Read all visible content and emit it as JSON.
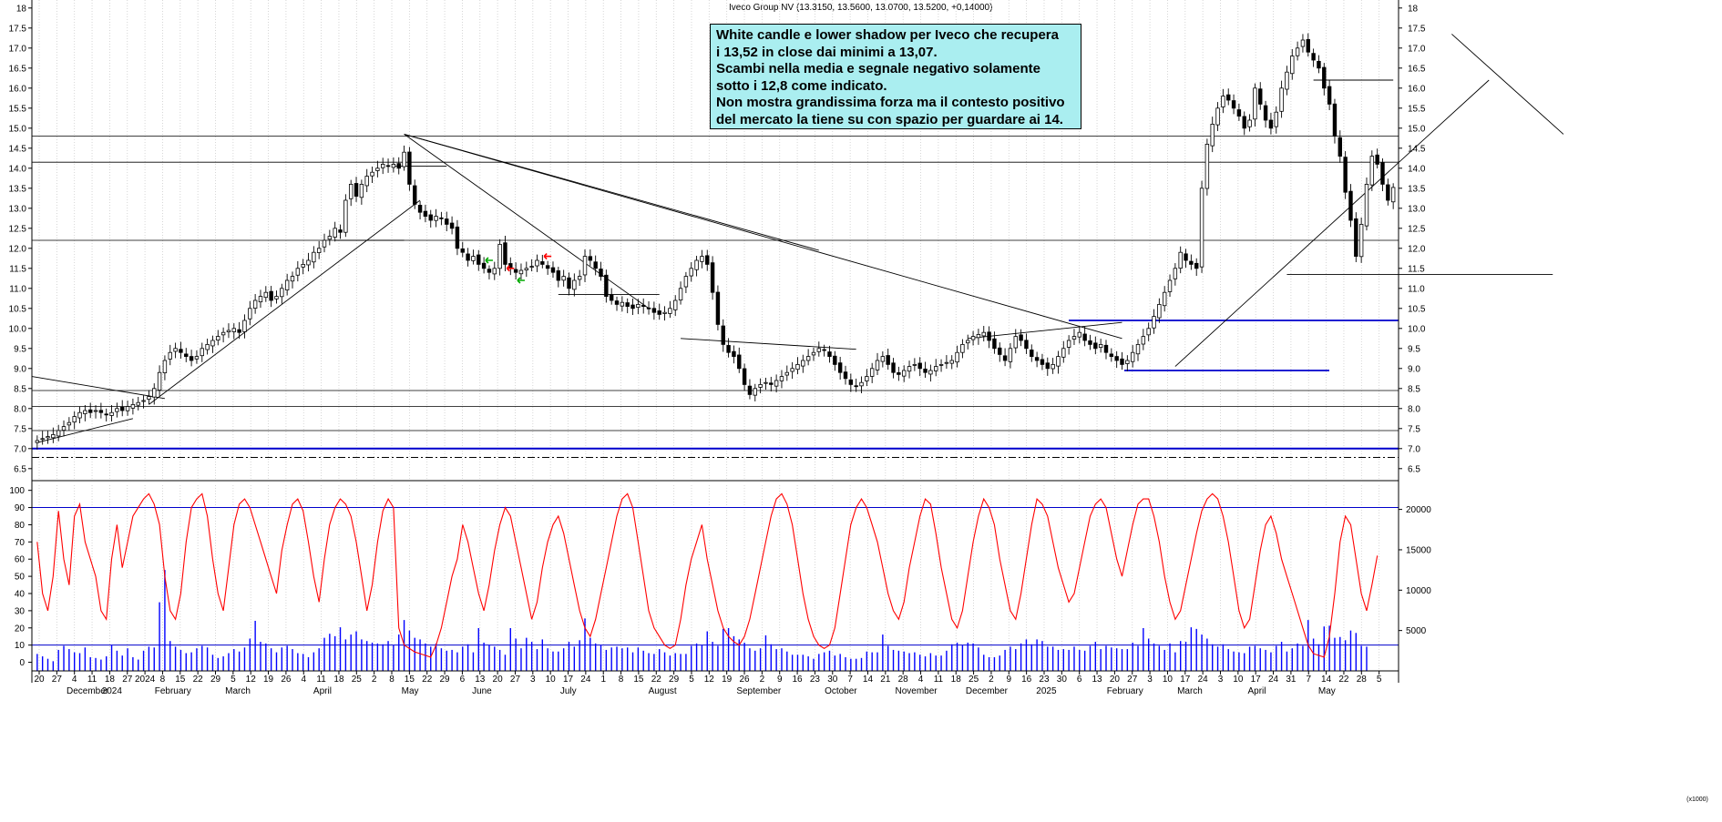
{
  "header": {
    "instrument": "Iveco Group NV",
    "values": "(13.3150, 13.5600, 13.0700, 13.5200, +0,14000)"
  },
  "annotation": {
    "lines": [
      "White candle e lower shadow per Iveco che recupera",
      "i 13,52 in close dai minimi a 13,07.",
      "Scambi nella media e segnale negativo solamente",
      "sotto i 12,8 come indicato.",
      "Non mostra grandissima forza ma il contesto positivo",
      "del mercato la tiene su con spazio per guardare ai 14."
    ]
  },
  "corner_label": "(x1000)",
  "colors": {
    "trend_black": "#000000",
    "level_blue": "#0000cc",
    "oscillator_red": "#ff0000",
    "volume_blue": "#0000ff",
    "note_bg": "#aaeef0"
  },
  "chart_data": [
    {
      "type": "candlestick",
      "panel": "price",
      "y_axis": {
        "ticks": [
          "6.5",
          "7.0",
          "7.5",
          "8.0",
          "8.5",
          "9.0",
          "9.5",
          "10.0",
          "10.5",
          "11.0",
          "11.5",
          "12.0",
          "12.5",
          "13.0",
          "13.5",
          "14.0",
          "14.5",
          "15.0",
          "15.5",
          "16.0",
          "16.5",
          "17.0",
          "17.5",
          "18"
        ],
        "sides": "both"
      },
      "ylim": [
        6.2,
        18.2
      ],
      "grid": "vertical-dotted",
      "series": [
        {
          "close": [
            7.2,
            7.25,
            7.3,
            7.35,
            7.45,
            7.55,
            7.65,
            7.8,
            7.9,
            7.95,
            7.9,
            7.95,
            7.9,
            7.85,
            7.9,
            8.0,
            7.95,
            8.05,
            8.1,
            8.15,
            8.2,
            8.3,
            8.5,
            8.9,
            9.2,
            9.4,
            9.5,
            9.4,
            9.3,
            9.2,
            9.3,
            9.5,
            9.6,
            9.7,
            9.8,
            9.9,
            9.95,
            10.0,
            9.9,
            10.2,
            10.5,
            10.7,
            10.8,
            10.9,
            10.7,
            10.8,
            11.0,
            11.2,
            11.3,
            11.5,
            11.6,
            11.7,
            11.9,
            12.0,
            12.2,
            12.3,
            12.5,
            12.4,
            13.2,
            13.6,
            13.3,
            13.6,
            13.8,
            13.9,
            14.0,
            14.1,
            14.05,
            14.1,
            14.0,
            14.4,
            13.6,
            13.1,
            12.9,
            12.8,
            12.7,
            12.8,
            12.75,
            12.6,
            12.5,
            12.0,
            11.9,
            11.7,
            11.8,
            11.6,
            11.5,
            11.4,
            11.5,
            12.1,
            11.6,
            11.5,
            11.4,
            11.45,
            11.5,
            11.55,
            11.7,
            11.6,
            11.5,
            11.4,
            11.2,
            11.3,
            11.0,
            11.2,
            11.3,
            11.8,
            11.7,
            11.5,
            11.3,
            10.8,
            10.7,
            10.6,
            10.65,
            10.55,
            10.5,
            10.6,
            10.55,
            10.5,
            10.4,
            10.35,
            10.4,
            10.5,
            10.7,
            11.0,
            11.3,
            11.5,
            11.7,
            11.8,
            11.6,
            10.9,
            10.1,
            9.6,
            9.4,
            9.3,
            9.0,
            8.6,
            8.35,
            8.5,
            8.6,
            8.65,
            8.6,
            8.7,
            8.8,
            8.9,
            9.0,
            9.1,
            9.2,
            9.3,
            9.4,
            9.5,
            9.45,
            9.3,
            9.1,
            8.9,
            8.75,
            8.6,
            8.55,
            8.65,
            8.8,
            9.0,
            9.2,
            9.3,
            9.1,
            8.9,
            8.85,
            8.95,
            9.05,
            9.1,
            9.0,
            8.9,
            8.95,
            9.05,
            9.1,
            9.15,
            9.2,
            9.4,
            9.6,
            9.7,
            9.8,
            9.85,
            9.9,
            9.7,
            9.5,
            9.35,
            9.2,
            9.5,
            9.8,
            9.7,
            9.5,
            9.3,
            9.2,
            9.1,
            9.0,
            9.1,
            9.3,
            9.5,
            9.7,
            9.8,
            9.9,
            9.7,
            9.6,
            9.5,
            9.6,
            9.4,
            9.3,
            9.2,
            9.1,
            9.2,
            9.4,
            9.6,
            9.8,
            10.0,
            10.3,
            10.6,
            10.9,
            11.2,
            11.5,
            11.9,
            11.7,
            11.6,
            11.5,
            13.5,
            14.6,
            15.1,
            15.5,
            15.8,
            15.7,
            15.5,
            15.3,
            15.0,
            15.2,
            16.0,
            15.6,
            15.2,
            15.0,
            15.4,
            16.0,
            16.4,
            16.8,
            17.0,
            17.2,
            16.9,
            16.7,
            16.5,
            16.0,
            15.6,
            14.8,
            14.3,
            13.4,
            12.7,
            11.8,
            12.6,
            13.6,
            14.3,
            14.1,
            13.6,
            13.2,
            13.52
          ]
        }
      ]
    },
    {
      "type": "line",
      "panel": "oscillator",
      "y_axis": {
        "ticks": [
          "0",
          "10",
          "20",
          "30",
          "40",
          "50",
          "60",
          "70",
          "80",
          "90",
          "100"
        ],
        "side": "left"
      },
      "ylim": [
        -5,
        103
      ],
      "reference_lines": [
        10,
        90
      ],
      "series": [
        {
          "values": [
            70,
            40,
            30,
            50,
            88,
            60,
            45,
            85,
            92,
            70,
            60,
            50,
            30,
            25,
            60,
            80,
            55,
            70,
            85,
            90,
            95,
            98,
            92,
            80,
            50,
            30,
            25,
            40,
            70,
            90,
            95,
            98,
            85,
            60,
            40,
            30,
            55,
            80,
            92,
            95,
            90,
            80,
            70,
            60,
            50,
            40,
            65,
            80,
            92,
            95,
            88,
            70,
            50,
            35,
            60,
            80,
            90,
            95,
            92,
            85,
            70,
            50,
            30,
            45,
            70,
            88,
            95,
            90,
            20,
            10,
            8,
            6,
            5,
            4,
            3,
            10,
            20,
            35,
            50,
            60,
            80,
            70,
            55,
            40,
            30,
            45,
            65,
            80,
            90,
            85,
            70,
            55,
            40,
            25,
            35,
            55,
            70,
            80,
            85,
            75,
            60,
            45,
            30,
            20,
            15,
            25,
            40,
            55,
            70,
            85,
            95,
            98,
            90,
            70,
            50,
            30,
            20,
            15,
            10,
            8,
            10,
            25,
            45,
            60,
            70,
            80,
            60,
            45,
            30,
            20,
            15,
            12,
            10,
            15,
            25,
            40,
            55,
            70,
            85,
            95,
            98,
            92,
            80,
            60,
            40,
            25,
            15,
            10,
            8,
            10,
            20,
            40,
            60,
            80,
            90,
            95,
            90,
            80,
            70,
            55,
            40,
            30,
            25,
            35,
            55,
            70,
            85,
            95,
            92,
            75,
            55,
            40,
            25,
            20,
            30,
            50,
            70,
            85,
            95,
            90,
            80,
            60,
            45,
            30,
            25,
            40,
            60,
            80,
            95,
            92,
            85,
            70,
            55,
            45,
            35,
            40,
            55,
            70,
            85,
            92,
            95,
            90,
            75,
            60,
            50,
            65,
            80,
            92,
            95,
            95,
            85,
            70,
            50,
            35,
            25,
            30,
            45,
            60,
            75,
            88,
            95,
            98,
            95,
            85,
            70,
            50,
            30,
            20,
            25,
            45,
            65,
            80,
            85,
            75,
            60,
            50,
            40,
            30,
            20,
            10,
            5,
            4,
            3,
            15,
            40,
            70,
            85,
            80,
            60,
            40,
            30,
            45,
            62
          ]
        }
      ]
    },
    {
      "type": "bar",
      "panel": "volume",
      "y_axis": {
        "ticks": [
          "5000",
          "10000",
          "15000",
          "20000"
        ],
        "side": "right",
        "unit_label": "(x1000)"
      },
      "ylim": [
        0,
        23000
      ],
      "series": [
        {
          "values": [
            2100,
            1800,
            1500,
            1200,
            2600,
            3100,
            2700,
            2300,
            2200,
            2900,
            1700,
            1600,
            1400,
            1800,
            3200,
            2500,
            1900,
            2800,
            1700,
            1400,
            2500,
            3000,
            2900,
            8500,
            12500,
            3700,
            3000,
            2600,
            2200,
            2300,
            2800,
            3100,
            2900,
            2000,
            1600,
            1800,
            2200,
            2700,
            2400,
            2900,
            4000,
            6200,
            3600,
            3400,
            2800,
            2300,
            2900,
            3100,
            2700,
            2200,
            2100,
            1700,
            2300,
            2800,
            4100,
            4600,
            4300,
            5400,
            3900,
            4500,
            4900,
            3900,
            3700,
            3500,
            3400,
            3300,
            3700,
            3200,
            4500,
            6300,
            5000,
            4100,
            3900,
            3400,
            3000,
            3400,
            2800,
            2500,
            2600,
            2300,
            3000,
            3300,
            2300,
            5300,
            3500,
            3200,
            3000,
            2600,
            2000,
            5300,
            4000,
            2800,
            4100,
            3600,
            2700,
            3900,
            2800,
            2400,
            2400,
            2800,
            3600,
            3000,
            3800,
            6500,
            4100,
            3400,
            3200,
            2600,
            2900,
            3000,
            2800,
            2900,
            2300,
            2900,
            2500,
            2200,
            2100,
            2700,
            2300,
            1900,
            2200,
            2100,
            2100,
            3100,
            3400,
            3200,
            4900,
            3600,
            3100,
            5200,
            5300,
            4300,
            3900,
            3500,
            2800,
            2500,
            2800,
            4400,
            3300,
            2700,
            2800,
            2400,
            2000,
            2000,
            2000,
            1800,
            1500,
            2100,
            2300,
            2500,
            1900,
            2100,
            1700,
            1500,
            1500,
            1600,
            2400,
            2300,
            2300,
            4500,
            3100,
            2600,
            2500,
            2400,
            2200,
            2300,
            2000,
            1800,
            2200,
            1900,
            1900,
            2500,
            3300,
            3500,
            3200,
            3500,
            3400,
            2900,
            2000,
            1700,
            1700,
            1900,
            2600,
            3000,
            2700,
            3400,
            3900,
            3300,
            3900,
            3700,
            3000,
            3000,
            2600,
            2700,
            2600,
            3000,
            2600,
            2500,
            3100,
            3600,
            2700,
            3100,
            2900,
            2800,
            2700,
            2700,
            3500,
            3100,
            5300,
            4000,
            3400,
            3100,
            2600,
            3400,
            2300,
            3700,
            3600,
            5400,
            5200,
            4500,
            4000,
            3300,
            3000,
            3300,
            2700,
            2400,
            2300,
            2200,
            3000,
            3100,
            2800,
            2600,
            2300,
            3100,
            3600,
            2400,
            2800,
            3400,
            3100,
            6300,
            4000,
            3300,
            5500,
            5600,
            4100,
            4200,
            3800,
            5000,
            4700,
            3100,
            3000
          ]
        }
      ]
    }
  ],
  "x_axis": {
    "day_ticks": [
      "20",
      "27",
      "4",
      "11",
      "18",
      "27",
      "2024",
      "8",
      "15",
      "22",
      "29",
      "5",
      "12",
      "19",
      "26",
      "4",
      "11",
      "18",
      "25",
      "2",
      "8",
      "15",
      "22",
      "29",
      "6",
      "13",
      "20",
      "27",
      "3",
      "10",
      "17",
      "24",
      "1",
      "8",
      "15",
      "22",
      "29",
      "5",
      "12",
      "19",
      "26",
      "2",
      "9",
      "16",
      "23",
      "30",
      "7",
      "14",
      "21",
      "28",
      "4",
      "11",
      "18",
      "25",
      "2",
      "9",
      "16",
      "23",
      "30",
      "6",
      "13",
      "20",
      "27",
      "3",
      "10",
      "17",
      "24",
      "3",
      "10",
      "17",
      "24",
      "31",
      "7",
      "14",
      "22",
      "28",
      "5"
    ],
    "months": [
      "December",
      "2024",
      "February",
      "March",
      "April",
      "May",
      "June",
      "July",
      "August",
      "September",
      "October",
      "November",
      "December",
      "2025",
      "February",
      "March",
      "April",
      "May"
    ]
  }
}
